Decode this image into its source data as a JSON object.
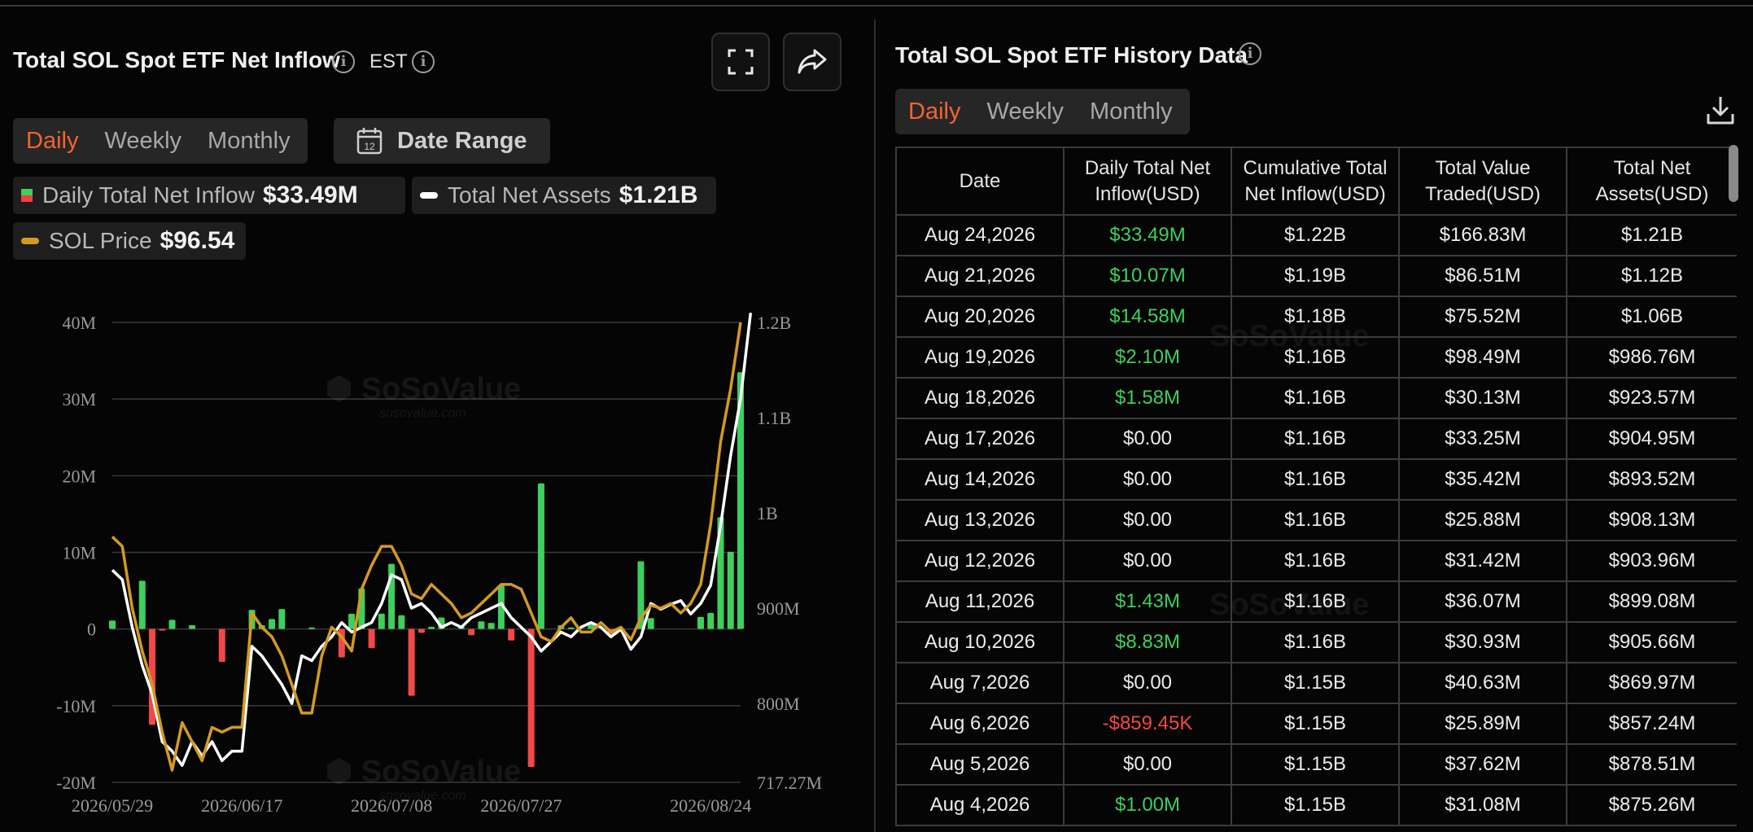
{
  "left": {
    "title": "Total SOL Spot ETF Net Inflow",
    "timezone": "EST",
    "tabs": [
      "Daily",
      "Weekly",
      "Monthly"
    ],
    "active_tab": "Daily",
    "date_range_label": "Date Range",
    "calendar_day": "12",
    "legend": [
      {
        "label": "Daily Total Net Inflow",
        "value": "$33.49M"
      },
      {
        "label": "Total Net Assets",
        "value": "$1.21B"
      },
      {
        "label": "SOL Price",
        "value": "$96.54"
      }
    ],
    "watermark": "SoSoValue",
    "watermark_sub": "sosovalue.com"
  },
  "right": {
    "title": "Total SOL Spot ETF History Data",
    "tabs": [
      "Daily",
      "Weekly",
      "Monthly"
    ],
    "active_tab": "Daily",
    "columns": [
      "Date",
      "Daily Total Net Inflow(USD)",
      "Cumulative Total Net Inflow(USD)",
      "Total Value Traded(USD)",
      "Total Net Assets(USD)"
    ],
    "rows": [
      [
        "Aug 24,2026",
        "$33.49M",
        "$1.22B",
        "$166.83M",
        "$1.21B"
      ],
      [
        "Aug 21,2026",
        "$10.07M",
        "$1.19B",
        "$86.51M",
        "$1.12B"
      ],
      [
        "Aug 20,2026",
        "$14.58M",
        "$1.18B",
        "$75.52M",
        "$1.06B"
      ],
      [
        "Aug 19,2026",
        "$2.10M",
        "$1.16B",
        "$98.49M",
        "$986.76M"
      ],
      [
        "Aug 18,2026",
        "$1.58M",
        "$1.16B",
        "$30.13M",
        "$923.57M"
      ],
      [
        "Aug 17,2026",
        "$0.00",
        "$1.16B",
        "$33.25M",
        "$904.95M"
      ],
      [
        "Aug 14,2026",
        "$0.00",
        "$1.16B",
        "$35.42M",
        "$893.52M"
      ],
      [
        "Aug 13,2026",
        "$0.00",
        "$1.16B",
        "$25.88M",
        "$908.13M"
      ],
      [
        "Aug 12,2026",
        "$0.00",
        "$1.16B",
        "$31.42M",
        "$903.96M"
      ],
      [
        "Aug 11,2026",
        "$1.43M",
        "$1.16B",
        "$36.07M",
        "$899.08M"
      ],
      [
        "Aug 10,2026",
        "$8.83M",
        "$1.16B",
        "$30.93M",
        "$905.66M"
      ],
      [
        "Aug 7,2026",
        "$0.00",
        "$1.15B",
        "$40.63M",
        "$869.97M"
      ],
      [
        "Aug 6,2026",
        "-$859.45K",
        "$1.15B",
        "$25.89M",
        "$857.24M"
      ],
      [
        "Aug 5,2026",
        "$0.00",
        "$1.15B",
        "$37.62M",
        "$878.51M"
      ],
      [
        "Aug 4,2026",
        "$1.00M",
        "$1.15B",
        "$31.08M",
        "$875.26M"
      ]
    ]
  },
  "colors": {
    "positive": "#3ecf5c",
    "negative": "#f24848",
    "accent": "#f26430",
    "net_assets_line": "#ffffff",
    "sol_price_line": "#d39a22"
  },
  "icons": [
    "info-icon",
    "expand-icon",
    "share-icon",
    "calendar-icon",
    "download-icon"
  ],
  "chart_data": {
    "type": "bar",
    "y_left": {
      "ticks": [
        "40M",
        "30M",
        "20M",
        "10M",
        "0",
        "-10M",
        "-20M"
      ],
      "range": [
        -20,
        40
      ],
      "unit": "M USD"
    },
    "y_right": {
      "ticks": [
        "1.2B",
        "1.1B",
        "1B",
        "900M",
        "800M",
        "717.27M"
      ],
      "range": [
        717.27,
        1200
      ],
      "unit": "M USD"
    },
    "x_ticks": [
      "2026/05/29",
      "2026/06/17",
      "2026/07/08",
      "2026/07/27",
      "2026/08/24"
    ],
    "x_tick_index": [
      0,
      13,
      28,
      41,
      60
    ],
    "grid": true,
    "series": [
      {
        "name": "Daily Total Net Inflow",
        "kind": "bar",
        "axis": "left",
        "values": [
          1.1,
          0,
          0,
          6.3,
          -12.5,
          -0.2,
          1.2,
          0,
          0.5,
          0,
          0,
          -4.3,
          0,
          0,
          2.5,
          0.5,
          1.3,
          2.6,
          0,
          0,
          0.2,
          0,
          0,
          -3.7,
          2,
          5.3,
          -2.5,
          2,
          8.5,
          1.8,
          -8.7,
          -0.5,
          0.3,
          1.5,
          0,
          0.3,
          -0.8,
          1,
          0.8,
          5.7,
          -1.5,
          0,
          -18,
          19,
          0,
          0.5,
          0.2,
          0,
          0.6,
          0,
          -0.7,
          0,
          0,
          8.83,
          1.43,
          0,
          0,
          0,
          0,
          1.58,
          2.1,
          14.58,
          10.07,
          33.49
        ]
      },
      {
        "name": "Total Net Assets",
        "kind": "line",
        "axis": "right",
        "values": [
          940,
          930,
          880,
          840,
          810,
          760,
          750,
          735,
          760,
          745,
          760,
          740,
          750,
          750,
          860,
          850,
          835,
          820,
          800,
          850,
          845,
          860,
          870,
          885,
          875,
          880,
          885,
          905,
          935,
          930,
          900,
          905,
          895,
          880,
          885,
          880,
          890,
          895,
          900,
          905,
          890,
          880,
          870,
          855,
          865,
          875,
          870,
          880,
          885,
          880,
          870,
          878,
          857,
          870,
          905,
          899,
          904,
          908,
          894,
          905,
          924,
          987,
          1060,
          1120,
          1210
        ]
      },
      {
        "name": "SOL Price",
        "kind": "line",
        "axis": "right",
        "values": [
          975,
          965,
          900,
          855,
          820,
          770,
          730,
          780,
          760,
          740,
          775,
          770,
          775,
          775,
          895,
          880,
          870,
          850,
          820,
          790,
          790,
          850,
          880,
          870,
          855,
          920,
          945,
          965,
          965,
          945,
          915,
          910,
          925,
          915,
          905,
          890,
          895,
          905,
          915,
          925,
          925,
          920,
          895,
          870,
          865,
          880,
          890,
          875,
          875,
          885,
          875,
          880,
          867,
          890,
          903,
          900,
          905,
          895,
          905,
          925,
          988,
          1075,
          1130,
          1200
        ]
      }
    ]
  }
}
